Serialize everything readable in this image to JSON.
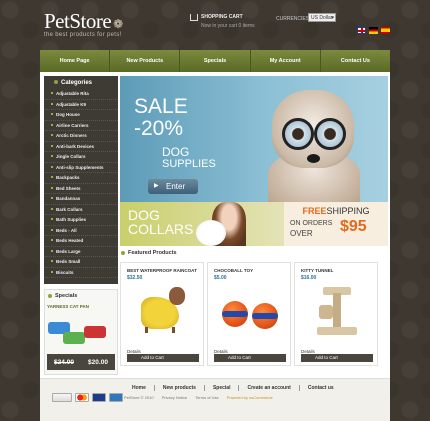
{
  "header": {
    "logo": "PetStore",
    "tagline": "the best products for pets!",
    "cart_title": "SHOPPING CART",
    "cart_status": "Now in your cart 0 items",
    "currencies_label": "CURRENCIES:",
    "currency_value": "US Dollar",
    "flags": [
      "en",
      "de",
      "es"
    ]
  },
  "nav": {
    "items": [
      "Home Page",
      "New Products",
      "Specials",
      "My Account",
      "Contact Us"
    ]
  },
  "sidebar": {
    "categories_title": "Categories",
    "categories": [
      "Adjustable Rita",
      "Adjustable K9",
      "Dog House",
      "Airline Carriers",
      "Arctic Dinners",
      "Anti-bark Devices",
      "Jingle Collars",
      "Anti-slip Supplements",
      "Backpacks",
      "Bed Sheets",
      "Bandannas",
      "Bark Collars",
      "Bath Supplies",
      "Beds - All",
      "Beds Heated",
      "Beds Large",
      "Beds Small",
      "Biscuits"
    ],
    "specials_title": "Specials",
    "special_name": "YARNESS CAT PAN",
    "special_old_price": "$24.00",
    "special_new_price": "$20.00"
  },
  "hero": {
    "sale": "SALE",
    "percent": "-20%",
    "dog": "DOG",
    "supplies": "SUPPLIES",
    "enter_label": "Enter"
  },
  "banners": {
    "collars_line1": "DOG",
    "collars_line2": "COLLARS",
    "ship_free": "FREE",
    "ship_rest": "SHIPPING",
    "ship_on_orders": "ON ORDERS",
    "ship_over": "OVER",
    "ship_amount": "$95"
  },
  "featured": {
    "title": "Featured Products",
    "products": [
      {
        "name": "BEST WATERPROOF RAINCOAT",
        "price": "$32.50",
        "details": "Details",
        "add": "Add to Cart"
      },
      {
        "name": "CHOCOBALL TOY",
        "price": "$5.00",
        "details": "Details",
        "add": "Add to Cart"
      },
      {
        "name": "KITTY TUNNEL",
        "price": "$16.00",
        "details": "Details",
        "add": "Add to Cart"
      }
    ]
  },
  "footer": {
    "links": [
      "Home",
      "New products",
      "Special",
      "Create an account",
      "Contact us"
    ],
    "copyright": "PetStore © 2010",
    "privacy": "Privacy Notice",
    "terms": "Terms of Use",
    "powered": "Powered by osCommerce"
  },
  "colors": {
    "accent_green": "#6b7a32",
    "price_blue": "#2b6f9e",
    "orange": "#e36a1c"
  }
}
